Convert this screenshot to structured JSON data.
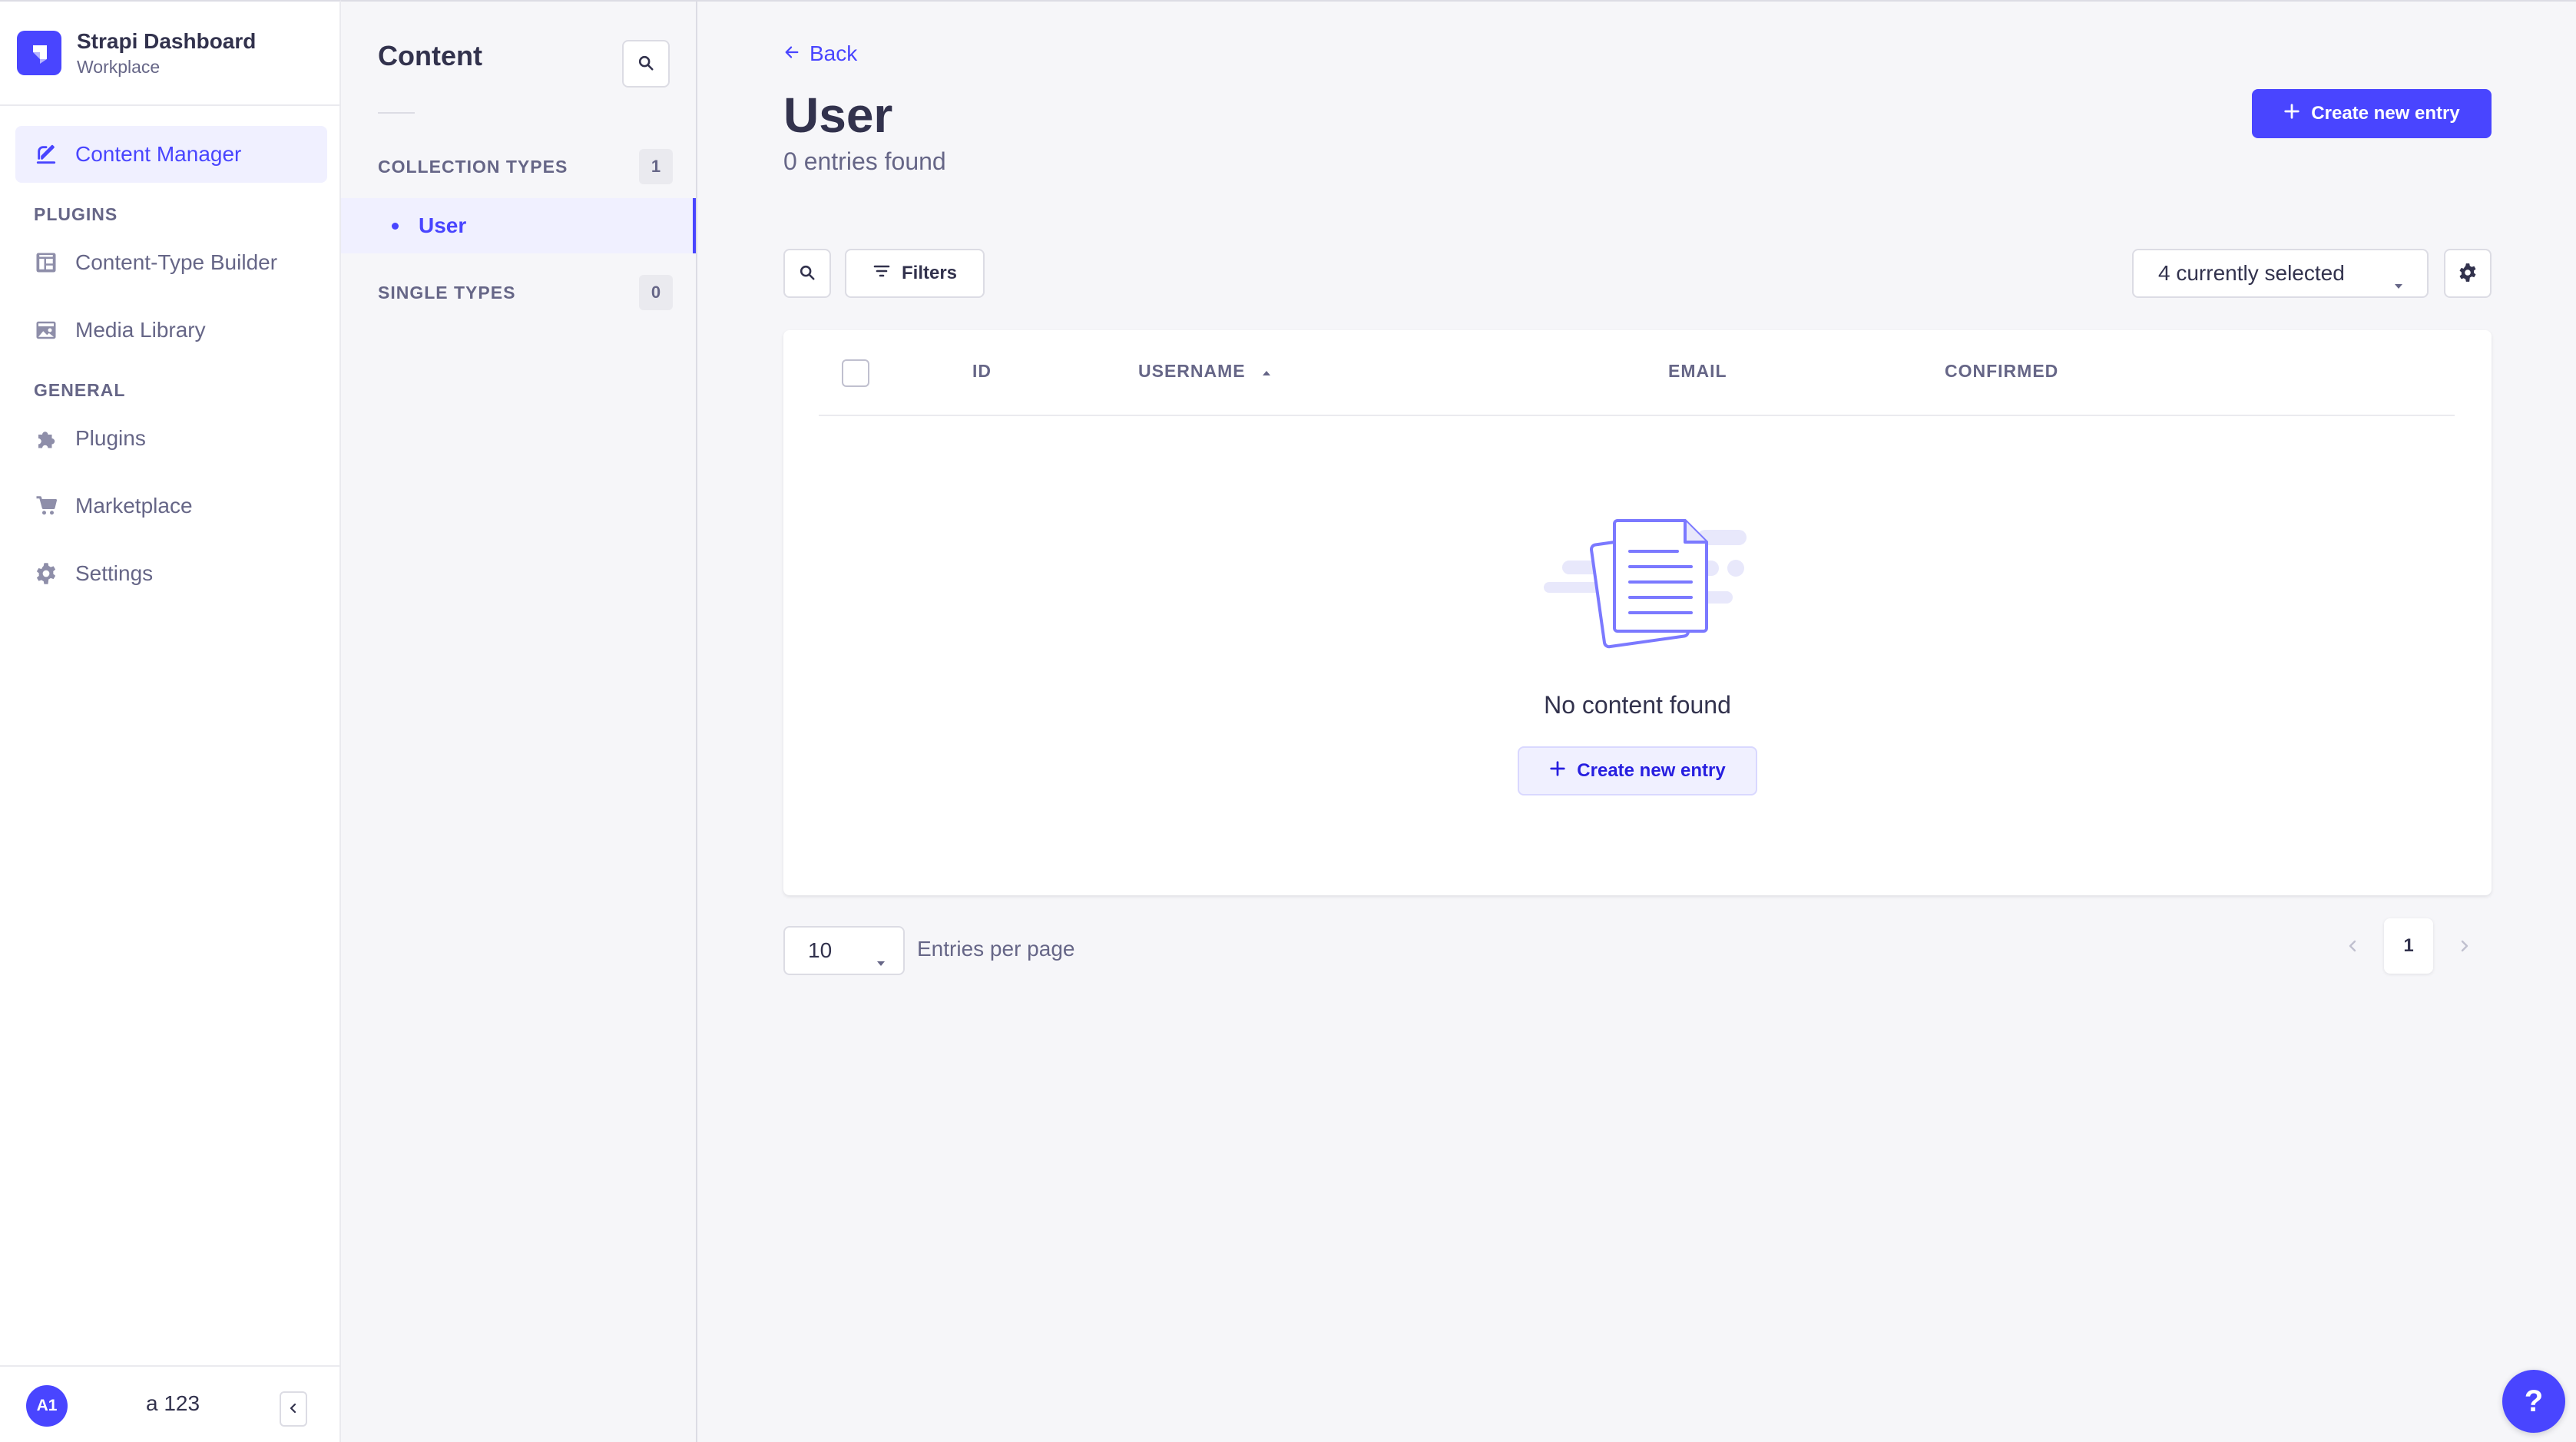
{
  "brand": {
    "title": "Strapi Dashboard",
    "subtitle": "Workplace",
    "accent": "#4945ff"
  },
  "nav": {
    "active": {
      "label": "Content Manager",
      "icon": "feather-icon"
    },
    "plugins_heading": "PLUGINS",
    "plugins": [
      {
        "label": "Content-Type Builder",
        "icon": "layout-icon"
      },
      {
        "label": "Media Library",
        "icon": "image-icon"
      }
    ],
    "general_heading": "GENERAL",
    "general": [
      {
        "label": "Plugins",
        "icon": "puzzle-icon"
      },
      {
        "label": "Marketplace",
        "icon": "cart-icon"
      },
      {
        "label": "Settings",
        "icon": "gear-icon"
      }
    ]
  },
  "footer": {
    "initials": "A1",
    "username": "a 123"
  },
  "subnav": {
    "title": "Content",
    "collection_types": {
      "label": "COLLECTION TYPES",
      "count": "1"
    },
    "collection_items": [
      {
        "label": "User"
      }
    ],
    "single_types": {
      "label": "SINGLE TYPES",
      "count": "0"
    }
  },
  "header": {
    "back_label": "Back",
    "title": "User",
    "subtitle": "0 entries found",
    "create_label": "Create new entry"
  },
  "toolbar": {
    "filters_label": "Filters",
    "columns_value": "4 currently selected"
  },
  "table": {
    "columns": [
      "ID",
      "USERNAME",
      "EMAIL",
      "CONFIRMED"
    ],
    "sorted_column": "USERNAME",
    "sort_direction": "ascending",
    "empty_text": "No content found",
    "empty_create_label": "Create new entry"
  },
  "pagination": {
    "page_size": "10",
    "page_size_label": "Entries per page",
    "current_page": "1"
  },
  "help": {
    "label": "?"
  }
}
